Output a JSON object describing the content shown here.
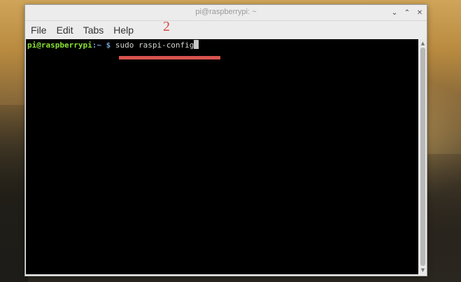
{
  "window": {
    "title": "pi@raspberrypi: ~"
  },
  "window_controls": {
    "minimize_icon": "chevron-down",
    "maximize_icon": "chevron-up",
    "close_icon": "x",
    "minimize_glyph": "⌄",
    "maximize_glyph": "⌃",
    "close_glyph": "✕"
  },
  "menubar": {
    "items": [
      "File",
      "Edit",
      "Tabs",
      "Help"
    ]
  },
  "annotation": {
    "step_number": "2",
    "color": "#d94a3f"
  },
  "terminal": {
    "prompt_user_host": "pi@raspberrypi",
    "prompt_sep": ":",
    "prompt_path": "~",
    "prompt_dollar": " $",
    "command": " sudo raspi-config",
    "colors": {
      "background": "#000000",
      "user_host": "#8ae234",
      "path": "#729fcf",
      "text": "#d3d7cf"
    }
  },
  "scrollbar": {
    "up_glyph": "▲",
    "down_glyph": "▼"
  }
}
